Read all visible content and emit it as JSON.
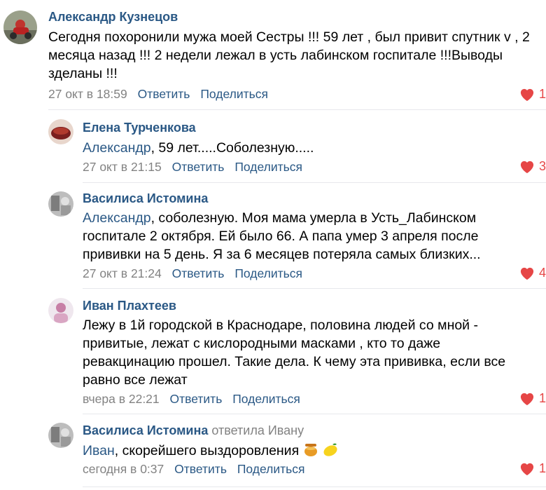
{
  "comments": [
    {
      "author": "Александр Кузнецов",
      "text": "Сегодня похоронили мужа моей Сестры !!! 59 лет , был привит спутник v , 2 месяца назад !!! 2 недели лежал в усть лабинском госпитале !!!Выводы зделаны !!!",
      "time": "27 окт в 18:59",
      "reply_label": "Ответить",
      "share_label": "Поделиться",
      "likes": "1"
    },
    {
      "author": "Елена Турченкова",
      "mention": "Александр",
      "text": ", 59 лет.....Соболезную.....",
      "time": "27 окт в 21:15",
      "reply_label": "Ответить",
      "share_label": "Поделиться",
      "likes": "3"
    },
    {
      "author": "Василиса Истомина",
      "mention": "Александр",
      "text": ", соболезную. Моя мама умерла в Усть_Лабинском госпитале 2 октября. Ей было 66. А папа умер 3 апреля после прививки на 5 день. Я за 6 месяцев потеряла самых близких...",
      "time": "27 окт в 21:24",
      "reply_label": "Ответить",
      "share_label": "Поделиться",
      "likes": "4"
    },
    {
      "author": "Иван Плахтеев",
      "text": "Лежу в 1й городской в Краснодаре, половина людей со мной - привитые, лежат с кислородными масками , кто то даже ревакцинацию прошел. Такие дела. К чему эта прививка, если все равно все лежат",
      "time": "вчера в 22:21",
      "reply_label": "Ответить",
      "share_label": "Поделиться",
      "likes": "1"
    },
    {
      "author": "Василиса Истомина",
      "replied_to": "ответила Ивану",
      "mention": "Иван",
      "text": ", скорейшего выздоровления",
      "time": "сегодня в 0:37",
      "reply_label": "Ответить",
      "share_label": "Поделиться",
      "likes": "1"
    }
  ],
  "colors": {
    "link": "#2a5885",
    "meta": "#828282",
    "like": "#e64646",
    "divider": "#e7e8ec"
  },
  "icons": [
    "heart-icon",
    "honey-pot-emoji",
    "lemon-emoji"
  ]
}
